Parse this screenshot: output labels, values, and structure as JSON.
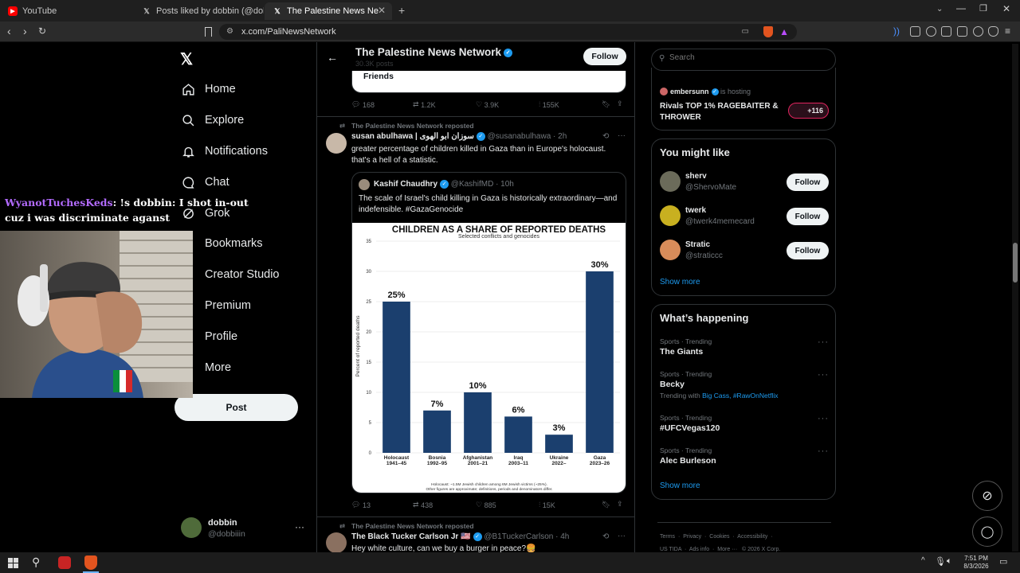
{
  "browser": {
    "tabs": [
      {
        "label": "YouTube",
        "active": false
      },
      {
        "label": "Posts liked by dobbin (@dobbiiin) / X",
        "active": false
      },
      {
        "label": "The Palestine News Network (@",
        "active": true
      }
    ],
    "url": "x.com/PaliNewsNetwork"
  },
  "sidebar": {
    "items": [
      {
        "label": "Home",
        "icon": "home-icon"
      },
      {
        "label": "Explore",
        "icon": "search-icon"
      },
      {
        "label": "Notifications",
        "icon": "bell-icon"
      },
      {
        "label": "Chat",
        "icon": "chat-icon"
      },
      {
        "label": "Grok",
        "icon": "grok-icon"
      },
      {
        "label": "Bookmarks",
        "icon": "bookmark-icon"
      },
      {
        "label": "Creator Studio",
        "icon": "creator-icon"
      },
      {
        "label": "Premium",
        "icon": "premium-icon"
      },
      {
        "label": "Profile",
        "icon": "profile-icon"
      },
      {
        "label": "More",
        "icon": "more-icon"
      }
    ],
    "post_label": "Post",
    "account": {
      "name": "dobbin",
      "handle": "@dobbiiin"
    }
  },
  "overlay": {
    "chat_user": "WyanotTuchesKeds",
    "chat_text": ": !s dobbin: I shot in-out cuz i was discriminate aganst"
  },
  "header": {
    "title": "The Palestine News Network",
    "subtitle": "30.3K posts",
    "follow_label": "Follow"
  },
  "prev_post": {
    "card_text": "Friends",
    "stats": {
      "replies": "168",
      "reposts": "1.2K",
      "likes": "3.9K",
      "views": "155K"
    }
  },
  "post1": {
    "repost_label": "The Palestine News Network reposted",
    "author": "susan abulhawa | سوزان ابو الهوى",
    "handle": "@susanabulhawa",
    "time": "· 2h",
    "text": "greater percentage of children killed in Gaza than in Europe's holocaust. that's a hell of a statistic.",
    "quote": {
      "author": "Kashif Chaudhry",
      "handle": "@KashifMD",
      "time": "· 10h",
      "text": "The scale of Israel's child killing in Gaza is historically extraordinary—and indefensible. #GazaGenocide"
    },
    "stats": {
      "replies": "13",
      "reposts": "438",
      "likes": "885",
      "views": "15K"
    }
  },
  "post2": {
    "repost_label": "The Palestine News Network reposted",
    "author": "The Black Tucker Carlson Jr 🇺🇸",
    "handle": "@B1TuckerCarlson",
    "time": "· 4h",
    "text": "Hey white culture, can we buy a burger in peace?🍔"
  },
  "chart_data": {
    "type": "bar",
    "title": "CHILDREN AS A SHARE OF REPORTED DEATHS",
    "subtitle": "Selected conflicts and genocides",
    "ylabel": "Percent of reported deaths",
    "xlabel": "",
    "ylim": [
      0,
      35
    ],
    "yticks": [
      "0",
      "5",
      "10",
      "15",
      "20",
      "25",
      "30",
      "35"
    ],
    "categories": [
      "Holocaust",
      "Bosnia",
      "Afghanistan",
      "Iraq",
      "Ukraine",
      "Gaza"
    ],
    "subcategories": [
      "1941–45",
      "1992–95",
      "2001–21",
      "2003–11",
      "2022–",
      "2023–26"
    ],
    "values": [
      25,
      7,
      10,
      6,
      3,
      30
    ],
    "value_labels": [
      "25%",
      "7%",
      "10%",
      "6%",
      "3%",
      "30%"
    ],
    "bar_color": "#1b3f6e",
    "footnote": "Holocaust: ~1.5M Jewish children among 6M Jewish victims (~25%). Other figures are approximate; definitions, periods and denominators differ."
  },
  "right": {
    "search_placeholder": "Search",
    "hosting": {
      "user": "embersunn",
      "status": "is hosting",
      "title": "Rivals TOP 1% RAGEBAITER & THROWER",
      "count": "+116"
    },
    "might_like_title": "You might like",
    "suggestions": [
      {
        "name": "sherv",
        "handle": "@ShervoMate"
      },
      {
        "name": "twerk",
        "handle": "@twerk4memecard"
      },
      {
        "name": "Stratic",
        "handle": "@straticcc"
      }
    ],
    "follow_label": "Follow",
    "show_more": "Show more",
    "happening_title": "What’s happening",
    "trends": [
      {
        "category": "Sports · Trending",
        "name": "The Giants",
        "extra_prefix": "",
        "extra_links": ""
      },
      {
        "category": "Sports · Trending",
        "name": "Becky",
        "extra_prefix": "Trending with",
        "extra_links": "Big Cass, #RawOnNetflix"
      },
      {
        "category": "Sports · Trending",
        "name": "#UFCVegas120",
        "extra_prefix": "",
        "extra_links": ""
      },
      {
        "category": "Sports · Trending",
        "name": "Alec Burleson",
        "extra_prefix": "",
        "extra_links": ""
      }
    ],
    "footer_links": [
      "Terms",
      "Privacy",
      "Cookies",
      "Accessibility"
    ],
    "footer_row2": [
      "US TIDA",
      "Ads info",
      "More ···",
      "© 2026 X Corp."
    ]
  },
  "taskbar": {
    "time": "7:51 PM",
    "date": "8/3/2026"
  },
  "colors": {
    "accent": "#1d9bf0",
    "border": "#2f3336",
    "muted": "#71767b"
  }
}
